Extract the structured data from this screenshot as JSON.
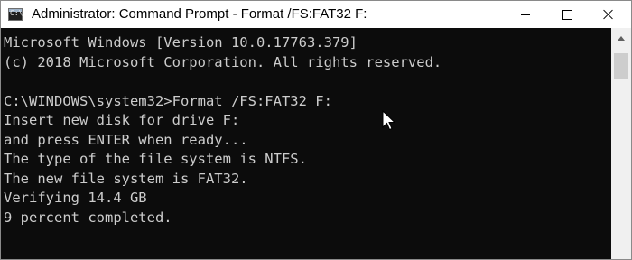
{
  "window": {
    "title": "Administrator: Command Prompt - Format  /FS:FAT32 F:",
    "app_icon_text": "C:\\",
    "controls": {
      "minimize": "minimize",
      "maximize": "maximize",
      "close": "close"
    }
  },
  "console": {
    "lines": [
      "Microsoft Windows [Version 10.0.17763.379]",
      "(c) 2018 Microsoft Corporation. All rights reserved.",
      "",
      "C:\\WINDOWS\\system32>Format /FS:FAT32 F:",
      "Insert new disk for drive F:",
      "and press ENTER when ready...",
      "The type of the file system is NTFS.",
      "The new file system is FAT32.",
      "Verifying 14.4 GB",
      "9 percent completed."
    ]
  },
  "colors": {
    "console_background": "#0c0c0c",
    "console_text": "#cccccc",
    "titlebar": "#ffffff"
  }
}
